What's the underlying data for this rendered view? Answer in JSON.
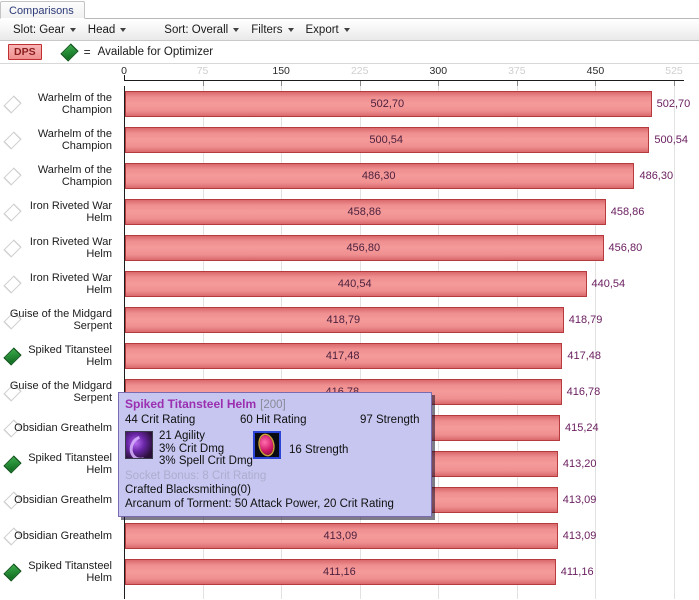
{
  "window": {
    "tab_label": "Comparisons"
  },
  "menu": {
    "items": [
      {
        "label": "Slot: Gear",
        "has_caret": true
      },
      {
        "label": "Head",
        "has_caret": true
      },
      {
        "label": "Sort: Overall",
        "has_caret": true
      },
      {
        "label": "Filters",
        "has_caret": true
      },
      {
        "label": "Export",
        "has_caret": true
      }
    ]
  },
  "legend": {
    "badge": "DPS",
    "marker_icon": "green-diamond-icon",
    "equals": "=",
    "text": "Available for Optimizer"
  },
  "chart_data": {
    "type": "bar",
    "orientation": "horizontal",
    "title": "",
    "xlabel": "",
    "ylabel": "",
    "xlim": [
      0,
      525
    ],
    "ticks": [
      0,
      75,
      150,
      225,
      300,
      375,
      450,
      525
    ],
    "tick_styles": [
      "major",
      "minor",
      "major",
      "minor",
      "major",
      "minor",
      "major",
      "minor"
    ],
    "grid": true,
    "legend_position": "top-left",
    "categories": [
      "Warhelm of the Champion",
      "Warhelm of the Champion",
      "Warhelm of the Champion",
      "Iron Riveted War Helm",
      "Iron Riveted War Helm",
      "Iron Riveted War Helm",
      "Guise of the Midgard Serpent",
      "Spiked Titansteel Helm",
      "Guise of the Midgard Serpent",
      "Obsidian Greathelm",
      "Spiked Titansteel Helm",
      "Obsidian Greathelm",
      "Obsidian Greathelm",
      "Spiked Titansteel Helm"
    ],
    "values": [
      502.7,
      500.54,
      486.3,
      458.86,
      456.8,
      440.54,
      418.79,
      417.48,
      416.78,
      415.24,
      413.2,
      413.09,
      413.09,
      411.16
    ],
    "value_labels": [
      "502,70",
      "500,54",
      "486,30",
      "458,86",
      "456,80",
      "440,54",
      "418,79",
      "417,48",
      "416,78",
      "415,24",
      "413,20",
      "413,09",
      "413,09",
      "411,16"
    ],
    "available_for_optimizer": [
      false,
      false,
      false,
      false,
      false,
      false,
      false,
      true,
      false,
      false,
      true,
      false,
      false,
      true
    ]
  },
  "colors": {
    "bar_fill": "#f59a9a",
    "bar_border": "#b63b3f",
    "value_label": "#6b2060",
    "badge_text": "#8b1d1d",
    "marker_available": "#0d6a1e",
    "tooltip_bg": "#c6c6f0",
    "tooltip_title": "#9b2fb0"
  },
  "tooltip": {
    "name": "Spiked Titansteel Helm",
    "level": "[200]",
    "stats": [
      "44 Crit Rating",
      "60 Hit Rating",
      "97 Strength"
    ],
    "gem1": {
      "icon": "purple-gem-icon",
      "lines": [
        "21 Agility",
        "3% Crit Dmg",
        "3% Spell Crit Dmg"
      ]
    },
    "gem2": {
      "icon": "pink-gem-icon",
      "text": "16 Strength"
    },
    "socket_bonus": "Socket Bonus: 8 Crit Rating",
    "crafted": "Crafted Blacksmithing(0)",
    "enchant": "Arcanum of Torment: 50 Attack Power, 20 Crit Rating"
  }
}
